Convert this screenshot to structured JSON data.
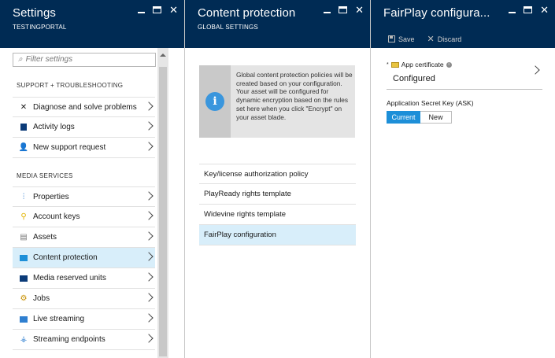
{
  "blade1": {
    "title": "Settings",
    "subtitle": "TESTINGPORTAL",
    "filter_placeholder": "Filter settings",
    "section_support": "SUPPORT + TROUBLESHOOTING",
    "support_items": [
      {
        "label": "Diagnose and solve problems",
        "icon": "wrench-icon"
      },
      {
        "label": "Activity logs",
        "icon": "activity-log-icon"
      },
      {
        "label": "New support request",
        "icon": "support-person-icon"
      }
    ],
    "section_media": "MEDIA SERVICES",
    "media_items": [
      {
        "label": "Properties",
        "icon": "properties-icon"
      },
      {
        "label": "Account keys",
        "icon": "key-icon"
      },
      {
        "label": "Assets",
        "icon": "assets-icon"
      },
      {
        "label": "Content protection",
        "icon": "content-protection-icon"
      },
      {
        "label": "Media reserved units",
        "icon": "reserved-units-icon"
      },
      {
        "label": "Jobs",
        "icon": "jobs-icon"
      },
      {
        "label": "Live streaming",
        "icon": "live-streaming-icon"
      },
      {
        "label": "Streaming endpoints",
        "icon": "streaming-endpoints-icon"
      }
    ]
  },
  "blade2": {
    "title": "Content protection",
    "subtitle": "GLOBAL SETTINGS",
    "info_text": "Global content protection policies will be created based on your configuration. Your asset will be configured for dynamic encryption based on the rules set here when you click \"Encrypt\" on your asset blade.",
    "items": [
      "Key/license authorization policy",
      "PlayReady rights template",
      "Widevine rights template",
      "FairPlay configuration"
    ]
  },
  "blade3": {
    "title": "FairPlay configura...",
    "save_label": "Save",
    "discard_label": "Discard",
    "cert_required_mark": "*",
    "cert_label": "App certificate",
    "cert_value": "Configured",
    "ask_label": "Application Secret Key (ASK)",
    "toggle_current": "Current",
    "toggle_new": "New"
  },
  "colors": {
    "header_bg": "#002b54",
    "selected_bg": "#d8eefa",
    "accent": "#1d8fd8",
    "info_blue": "#3a96dd"
  }
}
